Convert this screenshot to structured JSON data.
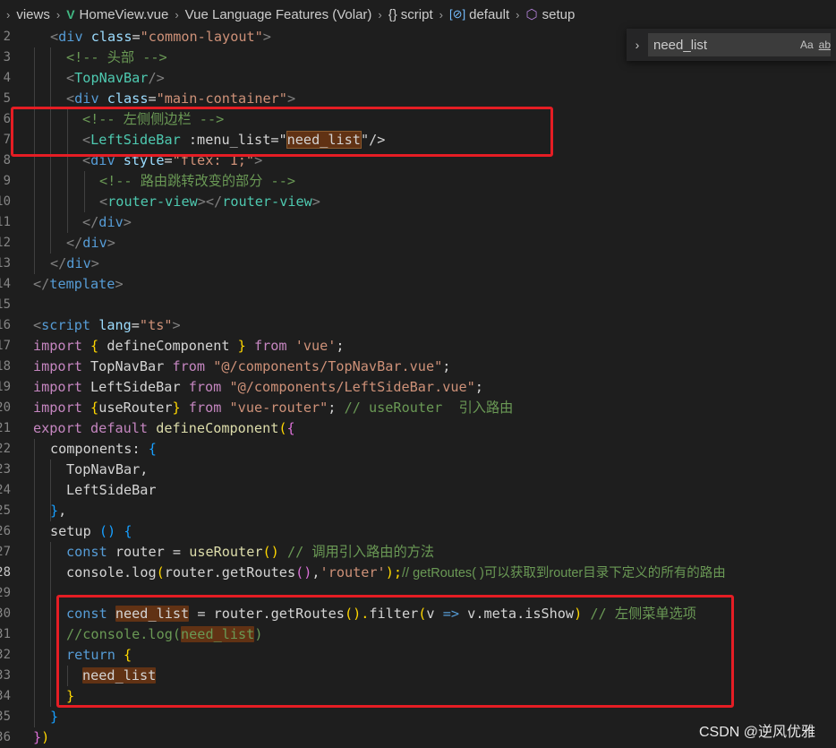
{
  "breadcrumb": {
    "items": [
      "views",
      "HomeView.vue",
      "Vue Language Features (Volar)",
      "script",
      "default",
      "setup"
    ]
  },
  "find_widget": {
    "query": "need_list",
    "match_case_label": "Aa",
    "whole_word_label": "ab"
  },
  "gutter": {
    "line_numbers": [
      "2",
      "3",
      "4",
      "5",
      "6",
      "7",
      "8",
      "9",
      "10",
      "11",
      "12",
      "13",
      "14",
      "15",
      "16",
      "17",
      "18",
      "19",
      "20",
      "21",
      "22",
      "23",
      "24",
      "25",
      "26",
      "27",
      "28",
      "29",
      "30",
      "31",
      "32",
      "33",
      "34",
      "35",
      "36"
    ],
    "active_line": "28"
  },
  "code": {
    "l2": [
      "<",
      "div",
      " ",
      "class",
      "=",
      "\"common-layout\"",
      ">"
    ],
    "l3": [
      "<!-- 头部 -->"
    ],
    "l4": [
      "<",
      "TopNavBar",
      "/>"
    ],
    "l5": [
      "<",
      "div",
      " ",
      "class",
      "=",
      "\"main-container\"",
      ">"
    ],
    "l6": [
      "<!-- 左侧侧边栏 -->"
    ],
    "l7": [
      "<",
      "LeftSideBar",
      " :",
      "menu_list",
      "=\"",
      "need_list",
      "\"/>"
    ],
    "l8": [
      "<",
      "div",
      " ",
      "style",
      "=",
      "\"flex: 1;\"",
      ">"
    ],
    "l9": [
      "<!-- 路由跳转改变的部分 -->"
    ],
    "l10": [
      "<",
      "router-view",
      "></",
      "router-view",
      ">"
    ],
    "l11": [
      "</",
      "div",
      ">"
    ],
    "l12": [
      "</",
      "div",
      ">"
    ],
    "l13": [
      "</",
      "div",
      ">"
    ],
    "l14": [
      "</",
      "template",
      ">"
    ],
    "l16": [
      "<",
      "script",
      " ",
      "lang",
      "=",
      "\"ts\"",
      ">"
    ],
    "l17": [
      "import",
      " ",
      "{",
      " defineComponent ",
      "}",
      " ",
      "from",
      " ",
      "'vue'",
      ";"
    ],
    "l18": [
      "import",
      " TopNavBar ",
      "from",
      " ",
      "\"@/components/TopNavBar.vue\"",
      ";"
    ],
    "l19": [
      "import",
      " LeftSideBar ",
      "from",
      " ",
      "\"@/components/LeftSideBar.vue\"",
      ";"
    ],
    "l20": [
      "import",
      " ",
      "{",
      "useRouter",
      "}",
      " ",
      "from",
      " ",
      "\"vue-router\"",
      "; ",
      "// useRouter  引入路由"
    ],
    "l21": [
      "export",
      " ",
      "default",
      " ",
      "defineComponent",
      "(",
      "{"
    ],
    "l22": [
      "components",
      ": ",
      "{"
    ],
    "l23": [
      "TopNavBar",
      ","
    ],
    "l24": [
      "LeftSideBar"
    ],
    "l25": [
      "}",
      ","
    ],
    "l26": [
      "setup",
      " ",
      "()",
      " ",
      "{"
    ],
    "l27": [
      "const",
      " ",
      "router",
      " = ",
      "useRouter",
      "()",
      " ",
      "// 调用引入路由的方法"
    ],
    "l28": [
      "console",
      ".",
      "log",
      "(",
      "router",
      ".",
      "getRoutes",
      "()",
      ",",
      "'router'",
      ");",
      "// getRoutes( )可以获取到router目录下定义的所有的路由"
    ],
    "l30": [
      "const",
      " ",
      "need_list",
      " = ",
      "router",
      ".",
      "getRoutes",
      "().",
      "filter",
      "(",
      "v",
      " ",
      "=>",
      " ",
      "v",
      ".",
      "meta",
      ".",
      "isShow",
      ")",
      " ",
      "// 左侧菜单选项"
    ],
    "l31": [
      "//console.log(",
      "need_list",
      ")"
    ],
    "l32": [
      "return",
      " ",
      "{"
    ],
    "l33": [
      "need_list"
    ],
    "l34": [
      "}"
    ],
    "l35": [
      "}"
    ],
    "l36": [
      "}",
      ")"
    ]
  },
  "watermark": "CSDN @逆风优雅",
  "colors": {
    "background": "#1e1e1e",
    "comment": "#6a9955",
    "string": "#ce9178",
    "tag": "#569cd6",
    "component": "#4ec9b0",
    "attribute": "#9cdcfe",
    "keyword": "#c586c0",
    "function": "#dcdcaa",
    "highlight_box": "#e51d24",
    "match_highlight": "#613214"
  }
}
